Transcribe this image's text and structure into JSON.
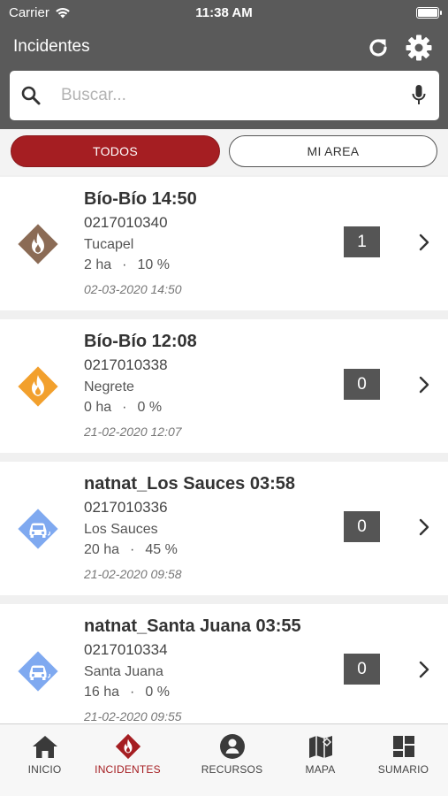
{
  "status_bar": {
    "carrier": "Carrier",
    "time": "11:38 AM"
  },
  "header": {
    "title": "Incidentes",
    "refresh_icon": "refresh-icon",
    "settings_icon": "gear-icon"
  },
  "search": {
    "placeholder": "Buscar...",
    "search_icon": "search-icon",
    "mic_icon": "microphone-icon"
  },
  "filters": {
    "all_label": "TODOS",
    "my_area_label": "MI AREA",
    "selected": "TODOS"
  },
  "incidents": [
    {
      "name": "Bío-Bío 14:50",
      "code": "0217010340",
      "place": "Tucapel",
      "area": "2 ha",
      "percent": "10 %",
      "date": "02-03-2020 14:50",
      "count": "1",
      "icon": "fire-brown-icon",
      "icon_color": "#8b6b55"
    },
    {
      "name": "Bío-Bío 12:08",
      "code": "0217010338",
      "place": "Negrete",
      "area": "0 ha",
      "percent": "0 %",
      "date": "21-02-2020 12:07",
      "count": "0",
      "icon": "fire-orange-icon",
      "icon_color": "#f2a02d"
    },
    {
      "name": "natnat_Los Sauces 03:58",
      "code": "0217010336",
      "place": "Los Sauces",
      "area": "20 ha",
      "percent": "45 %",
      "date": "21-02-2020 09:58",
      "count": "0",
      "icon": "vehicle-blue-icon",
      "icon_color": "#7fa9f0"
    },
    {
      "name": "natnat_Santa Juana 03:55",
      "code": "0217010334",
      "place": "Santa Juana",
      "area": "16 ha",
      "percent": "0 %",
      "date": "21-02-2020 09:55",
      "count": "0",
      "icon": "vehicle-blue-icon",
      "icon_color": "#7fa9f0"
    }
  ],
  "tab_bar": {
    "items": [
      {
        "label": "INICIO",
        "icon": "home-icon"
      },
      {
        "label": "INCIDENTES",
        "icon": "incident-fire-icon"
      },
      {
        "label": "RECURSOS",
        "icon": "resources-person-icon"
      },
      {
        "label": "MAPA",
        "icon": "map-icon"
      },
      {
        "label": "SUMARIO",
        "icon": "dashboard-icon"
      }
    ],
    "active": "INCIDENTES",
    "active_color": "#a51e22"
  },
  "colors": {
    "header_bg": "#5a5a5a",
    "accent": "#a51e22"
  }
}
